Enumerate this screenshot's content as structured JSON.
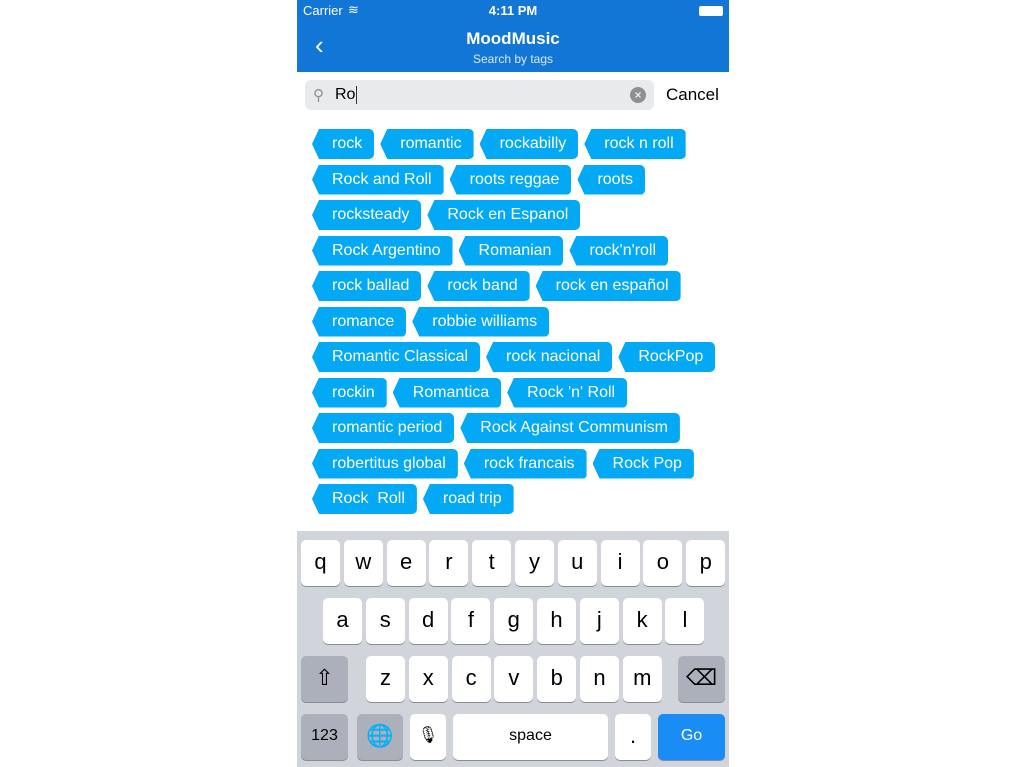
{
  "status_bar": {
    "carrier": "Carrier",
    "time": "4:11 PM"
  },
  "nav": {
    "back_icon": "chevron-left",
    "title": "MoodMusic",
    "subtitle": "Search by tags"
  },
  "search": {
    "value": "Ro",
    "cancel_label": "Cancel"
  },
  "tags": [
    "rock",
    "romantic",
    "rockabilly",
    "rock n roll",
    "Rock and Roll",
    "roots reggae",
    "roots",
    "rocksteady",
    "Rock en Espanol",
    "Rock Argentino",
    "Romanian",
    "rock'n'roll",
    "rock ballad",
    "rock band",
    "rock en español",
    "romance",
    "robbie williams",
    "Romantic Classical",
    "rock nacional",
    "RockPop",
    "rockin",
    "Romantica",
    "Rock 'n' Roll",
    "romantic period",
    "Rock Against Communism",
    "robertitus global",
    "rock francais",
    "Rock Pop",
    "Rock  Roll",
    "road trip"
  ],
  "keyboard": {
    "row1": [
      "q",
      "w",
      "e",
      "r",
      "t",
      "y",
      "u",
      "i",
      "o",
      "p"
    ],
    "row2": [
      "a",
      "s",
      "d",
      "f",
      "g",
      "h",
      "j",
      "k",
      "l"
    ],
    "row3": [
      "z",
      "x",
      "c",
      "v",
      "b",
      "n",
      "m"
    ],
    "numbers_label": "123",
    "space_label": "space",
    "period_label": ".",
    "go_label": "Go"
  },
  "colors": {
    "nav": "#1276d6",
    "tag": "#03a9f4",
    "go": "#1a8cf5"
  }
}
